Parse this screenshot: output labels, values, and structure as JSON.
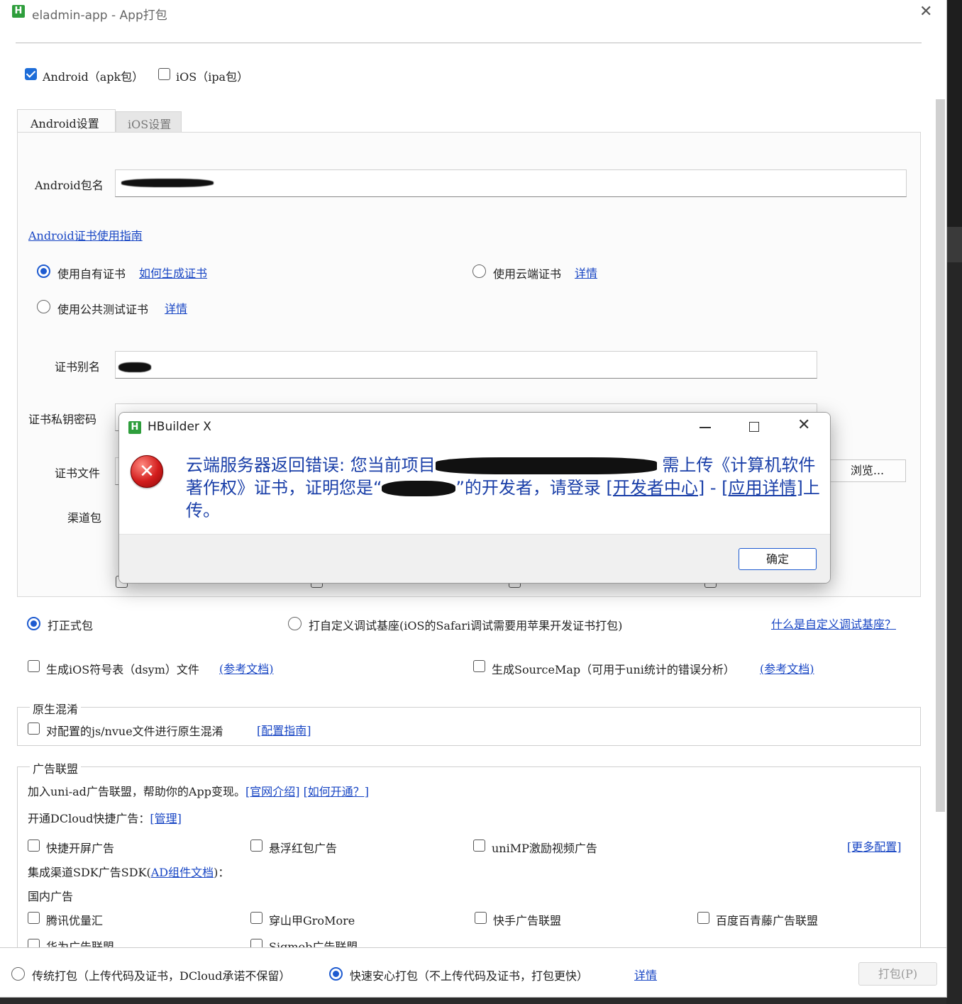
{
  "window": {
    "title": "eladmin-app - App打包"
  },
  "targets": [
    {
      "label": "Android（apk包）",
      "checked": true
    },
    {
      "label": "iOS（ipa包）",
      "checked": false
    }
  ],
  "tabs": [
    {
      "label": "Android设置",
      "active": true
    },
    {
      "label": "iOS设置",
      "active": false
    }
  ],
  "android": {
    "package_label": "Android包名",
    "cert_guide_link": "Android证书使用指南",
    "cert_options": [
      {
        "label": "使用自有证书",
        "link": "如何生成证书",
        "selected": true
      },
      {
        "label": "使用云端证书",
        "link": "详情",
        "selected": false
      },
      {
        "label": "使用公共测试证书",
        "link": "详情",
        "selected": false
      }
    ],
    "alias_label": "证书别名",
    "password_label": "证书私钥密码",
    "file_label": "证书文件",
    "browse_label": "浏览...",
    "channel_label": "渠道包"
  },
  "build_mode": {
    "options": [
      {
        "label": "打正式包",
        "selected": true
      },
      {
        "label": "打自定义调试基座(iOS的Safari调试需要用苹果开发证书打包)",
        "selected": false
      }
    ],
    "help_link": "什么是自定义调试基座？"
  },
  "extras": [
    {
      "label": "生成iOS符号表（dsym）文件",
      "link": "(参考文档)"
    },
    {
      "label": "生成SourceMap（可用于uni统计的错误分析）",
      "link": "(参考文档)"
    }
  ],
  "obfuscation": {
    "title": "原生混淆",
    "option": "对配置的js/nvue文件进行原生混淆",
    "link": "[配置指南]"
  },
  "ads": {
    "title": "广告联盟",
    "intro": "加入uni-ad广告联盟，帮助你的App变现。",
    "intro_link1": "[官网介绍]",
    "intro_link2": "[如何开通？]",
    "dcloud_label": "开通DCloud快捷广告：",
    "dcloud_link": "[管理]",
    "quick": [
      "快捷开屏广告",
      "悬浮红包广告",
      "uniMP激励视频广告"
    ],
    "more_link": "[更多配置]",
    "sdk_prefix": "集成渠道SDK广告SDK(",
    "sdk_link": "AD组件文档",
    "sdk_suffix": ")：",
    "domestic_label": "国内广告",
    "domestic": [
      "腾讯优量汇",
      "穿山甲GroMore",
      "快手广告联盟",
      "百度百青藤广告联盟"
    ],
    "domestic_row2": [
      "华为广告联盟",
      "Sigmob广告联盟"
    ]
  },
  "footer": {
    "options": [
      {
        "label": "传统打包（上传代码及证书，DCloud承诺不保留）",
        "selected": false
      },
      {
        "label": "快速安心打包（不上传代码及证书，打包更快）",
        "selected": true
      }
    ],
    "detail_link": "详情",
    "pack_button": "打包(P)"
  },
  "dialog": {
    "title": "HBuilder X",
    "msg_part1": "云端服务器返回错误: 您当前项目",
    "msg_part2": " 需上传《计算机软件著作权》证书，证明您是“",
    "msg_part3": "”的开发者，请登录 ",
    "msg_link1": "[开发者中心]",
    "msg_part4": " - ",
    "msg_link2": "[应用详情]",
    "msg_part5": "上传。",
    "ok_label": "确定"
  },
  "colors": {
    "accent": "#1e5bd0",
    "link": "#1846c4",
    "dialog_text": "#1a3fa8",
    "brand_green": "#2e9e3c"
  }
}
